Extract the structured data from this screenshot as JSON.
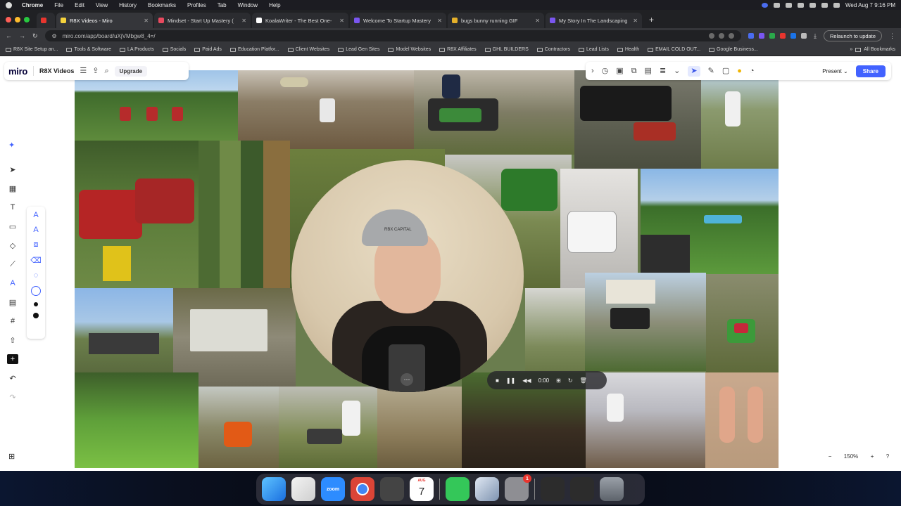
{
  "menubar": {
    "app": "Chrome",
    "items": [
      "File",
      "Edit",
      "View",
      "History",
      "Bookmarks",
      "Profiles",
      "Tab",
      "Window",
      "Help"
    ],
    "datetime": "Wed Aug 7  9:16 PM"
  },
  "tabs": [
    {
      "title": "R8X Videos - Miro",
      "color": "#f5d23c",
      "active": true
    },
    {
      "title": "Mindset - Start Up Mastery (",
      "color": "#e84a5f",
      "active": false
    },
    {
      "title": "KoalaWriter - The Best One-",
      "color": "#ffffff",
      "active": false
    },
    {
      "title": "Welcome To Startup Mastery",
      "color": "#7a56f0",
      "active": false
    },
    {
      "title": "bugs bunny running GIF",
      "color": "#e5b02a",
      "active": false
    },
    {
      "title": "My Story In The Landscaping",
      "color": "#7a56f0",
      "active": false
    }
  ],
  "address": {
    "url": "miro.com/app/board/uXjVMbgw8_4=/",
    "relaunch": "Relaunch to update"
  },
  "bookmarks": {
    "items": [
      "R8X Site Setup an...",
      "Tools & Software",
      "LA Products",
      "Socials",
      "Paid Ads",
      "Education Platfor...",
      "Client Websites",
      "Lead Gen Sites",
      "Model Websites",
      "R8X Affiliates",
      "GHL BUILDERS",
      "Contractors",
      "Lead Lists",
      "Health",
      "EMAIL COLD OUT...",
      "Google Business..."
    ],
    "more": "»",
    "all": "All Bookmarks"
  },
  "miro": {
    "logo": "miro",
    "board_name": "R8X Videos",
    "upgrade": "Upgrade",
    "present": "Present",
    "share": "Share",
    "zoom": "150%",
    "accent": "#4262ff"
  },
  "webcam": {
    "cap_text": "RBX CAPITAL"
  },
  "recorder": {
    "time": "0:00"
  },
  "dock": {
    "calendar_month": "AUG",
    "calendar_day": "7",
    "zoom_label": "zoom",
    "badge": "1"
  }
}
